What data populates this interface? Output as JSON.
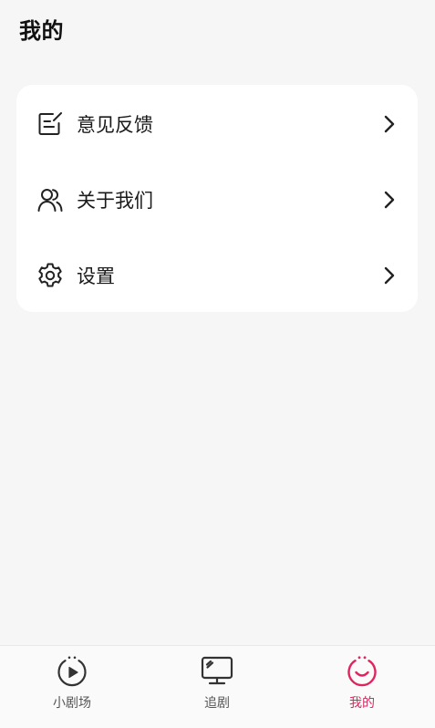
{
  "page": {
    "title": "我的"
  },
  "menu": {
    "items": [
      {
        "label": "意见反馈",
        "icon": "feedback-edit-icon"
      },
      {
        "label": "关于我们",
        "icon": "users-icon"
      },
      {
        "label": "设置",
        "icon": "gear-icon"
      }
    ]
  },
  "tabbar": {
    "tabs": [
      {
        "label": "小剧场",
        "icon": "play-circle-icon",
        "active": false
      },
      {
        "label": "追剧",
        "icon": "tv-icon",
        "active": false
      },
      {
        "label": "我的",
        "icon": "smile-icon",
        "active": true
      }
    ]
  },
  "colors": {
    "accent": "#e0245e",
    "background": "#f6f6f6",
    "card": "#ffffff"
  }
}
